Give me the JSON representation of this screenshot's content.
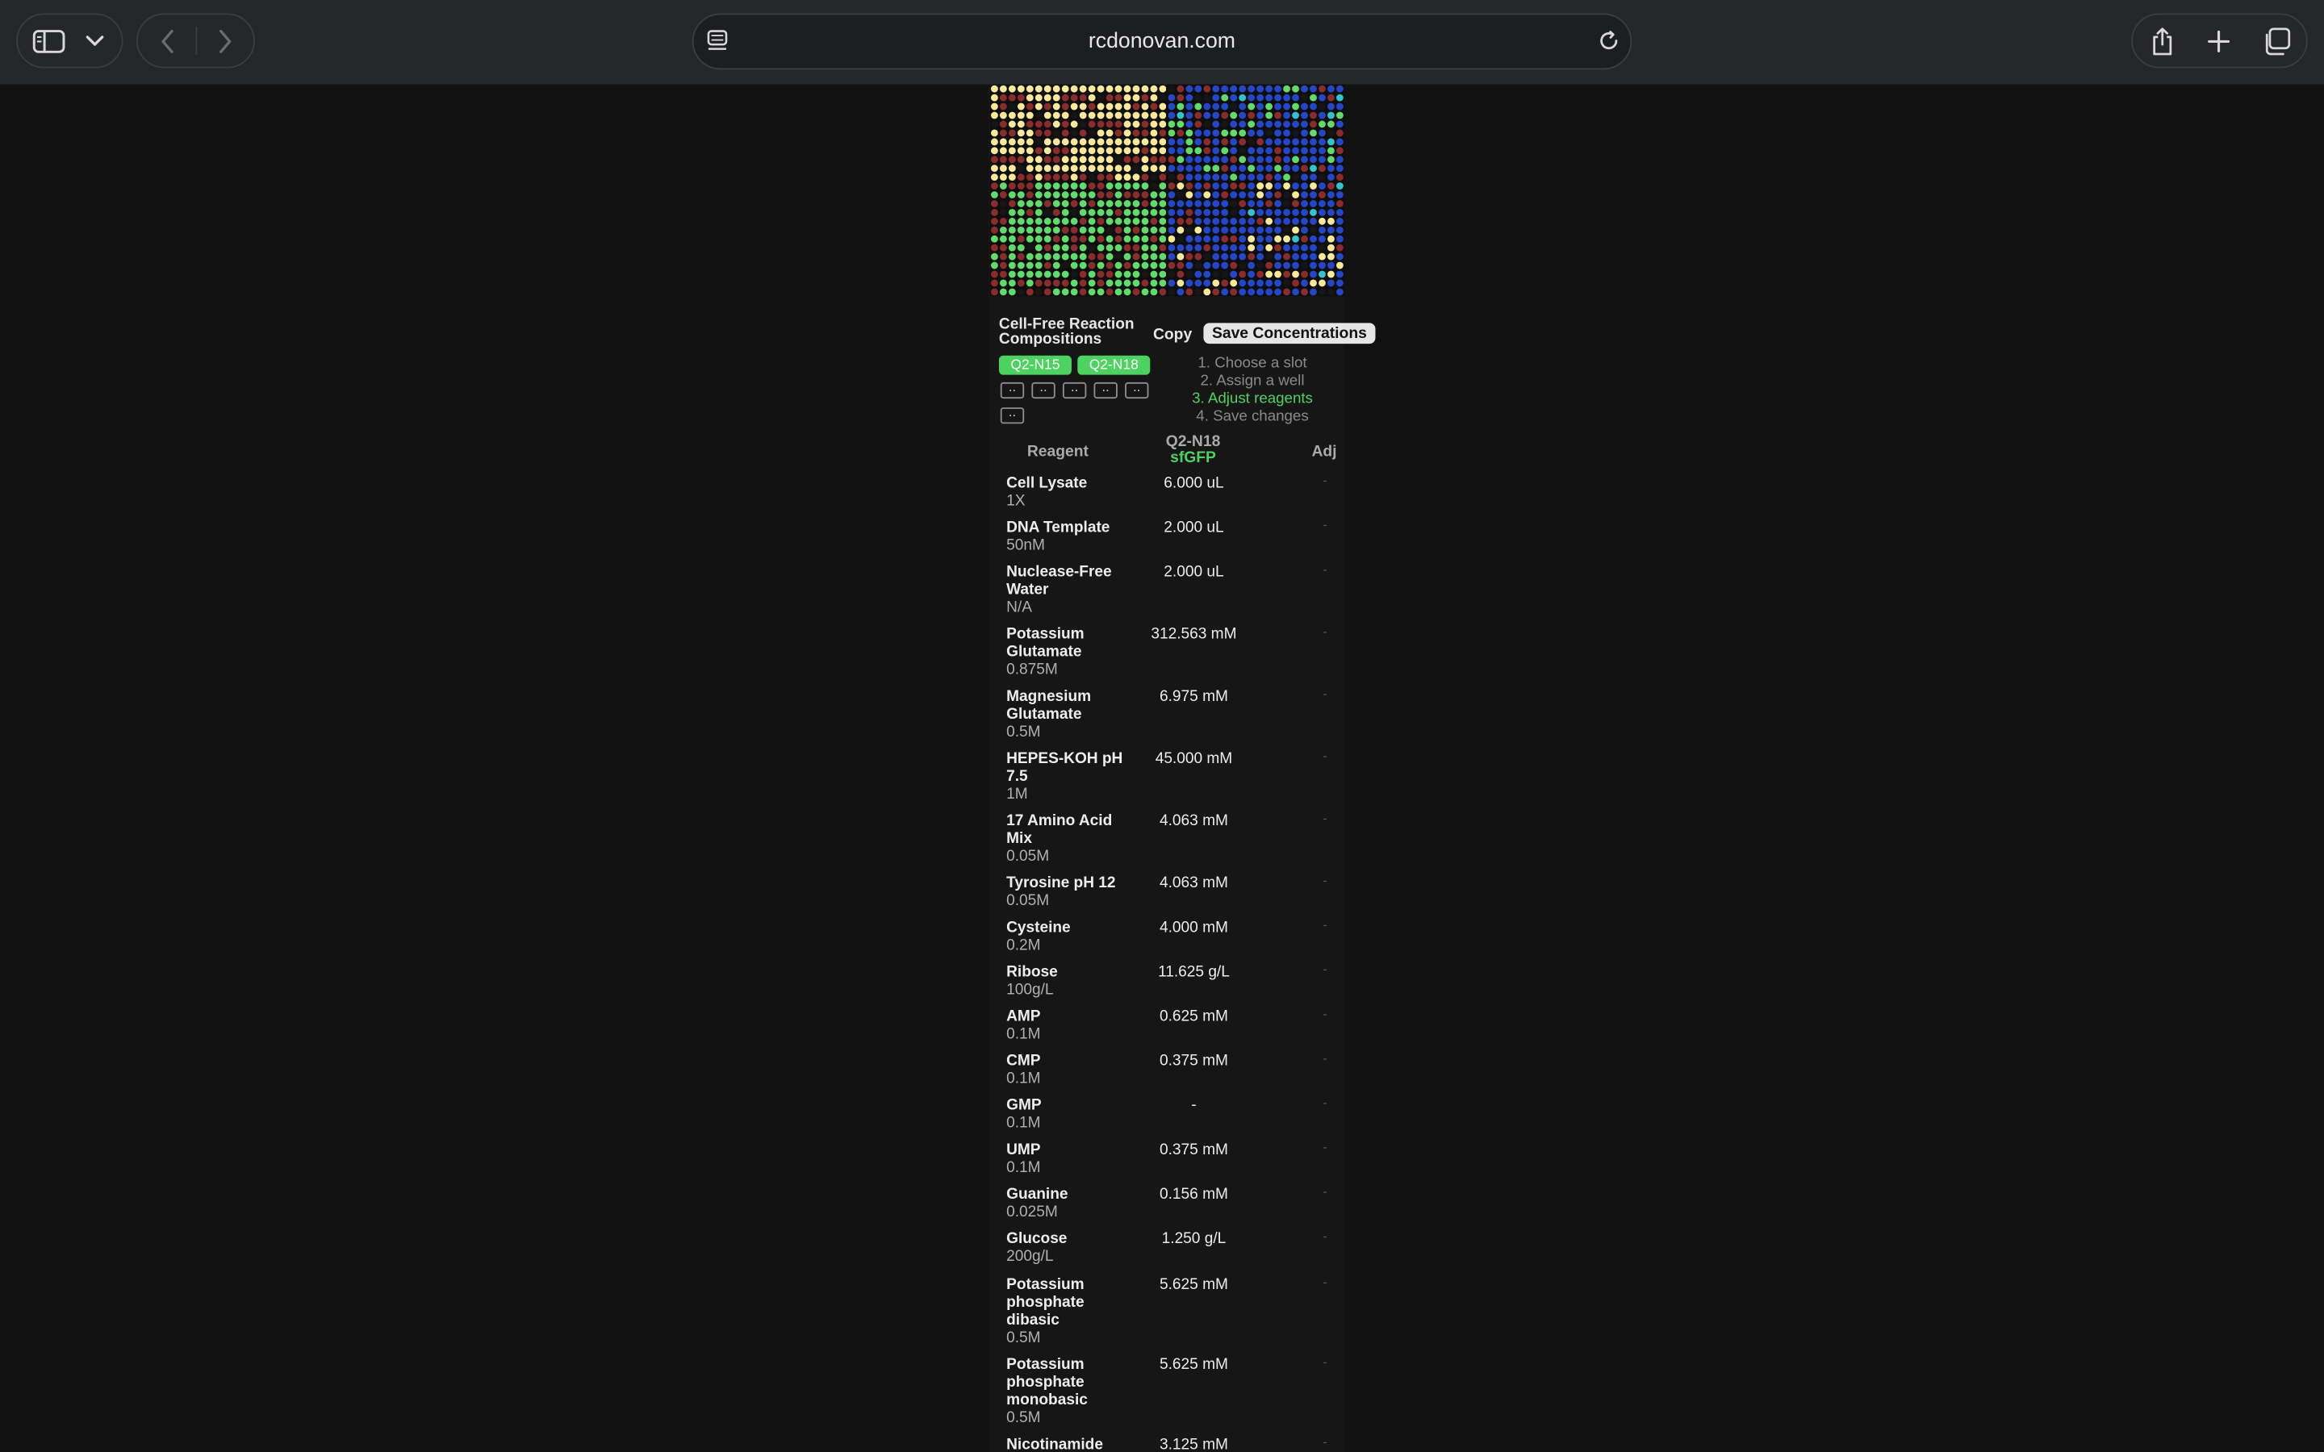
{
  "browser": {
    "url": "rcdonovan.com",
    "sidebar_icon": "sidebar-icon",
    "icons": [
      "sidebar-icon",
      "chevron-down-icon",
      "back-icon",
      "forward-icon",
      "reader-icon",
      "reload-icon",
      "share-icon",
      "plus-icon",
      "tabs-icon"
    ]
  },
  "plate": {
    "colors": {
      "green": "#5fdc6a",
      "yellow": "#fbe99a",
      "red": "#8a2c2c",
      "blue": "#2347c8",
      "black": "#151515",
      "cyan": "#31c4cf"
    }
  },
  "panel": {
    "title": "Cell-Free Reaction Compositions",
    "copy_label": "Copy",
    "save_label": "Save Concentrations",
    "tags": [
      "Q2-N15",
      "Q2-N18"
    ],
    "slots": [
      "..",
      "..",
      "..",
      "..",
      "..",
      ".."
    ],
    "steps": [
      "1. Choose a slot",
      "2. Assign a well",
      "3. Adjust reagents",
      "4. Save changes"
    ],
    "active_step": 2,
    "accent_color": "#4dd262"
  },
  "table": {
    "headers": {
      "reagent": "Reagent",
      "col_main": "Q2-N18",
      "col_sub": "sfGFP",
      "adj": "Adj"
    },
    "rows": [
      {
        "name": "Cell Lysate",
        "sub": "1X",
        "value": "6.000 uL",
        "adj": "-"
      },
      {
        "name": "DNA Template",
        "sub": "50nM",
        "value": "2.000 uL",
        "adj": "-"
      },
      {
        "name": "Nuclease-Free Water",
        "sub": "N/A",
        "value": "2.000 uL",
        "adj": "-"
      },
      {
        "name": "Potassium Glutamate",
        "sub": "0.875M",
        "value": "312.563 mM",
        "adj": "-"
      },
      {
        "name": "Magnesium Glutamate",
        "sub": "0.5M",
        "value": "6.975 mM",
        "adj": "-"
      },
      {
        "name": "HEPES-KOH pH 7.5",
        "sub": "1M",
        "value": "45.000 mM",
        "adj": "-"
      },
      {
        "name": "17 Amino Acid Mix",
        "sub": "0.05M",
        "value": "4.063 mM",
        "adj": "-"
      },
      {
        "name": "Tyrosine pH 12",
        "sub": "0.05M",
        "value": "4.063 mM",
        "adj": "-"
      },
      {
        "name": "Cysteine",
        "sub": "0.2M",
        "value": "4.000 mM",
        "adj": "-"
      },
      {
        "name": "Ribose",
        "sub": "100g/L",
        "value": "11.625 g/L",
        "adj": "-"
      },
      {
        "name": "AMP",
        "sub": "0.1M",
        "value": "0.625 mM",
        "adj": "-"
      },
      {
        "name": "CMP",
        "sub": "0.1M",
        "value": "0.375 mM",
        "adj": "-"
      },
      {
        "name": "GMP",
        "sub": "0.1M",
        "value": "-",
        "adj": "-"
      },
      {
        "name": "UMP",
        "sub": "0.1M",
        "value": "0.375 mM",
        "adj": "-"
      },
      {
        "name": "Guanine",
        "sub": "0.025M",
        "value": "0.156 mM",
        "adj": "-"
      },
      {
        "name": "Glucose",
        "sub": "200g/L",
        "value": "1.250 g/L",
        "adj": "-"
      },
      {
        "name": "Potassium phosphate dibasic",
        "sub": "0.5M",
        "value": "5.625 mM",
        "adj": "-"
      },
      {
        "name": "Potassium phosphate monobasic",
        "sub": "0.5M",
        "value": "5.625 mM",
        "adj": "-"
      },
      {
        "name": "Nicotinamide",
        "sub": "",
        "value": "3.125 mM",
        "adj": "-"
      }
    ]
  }
}
